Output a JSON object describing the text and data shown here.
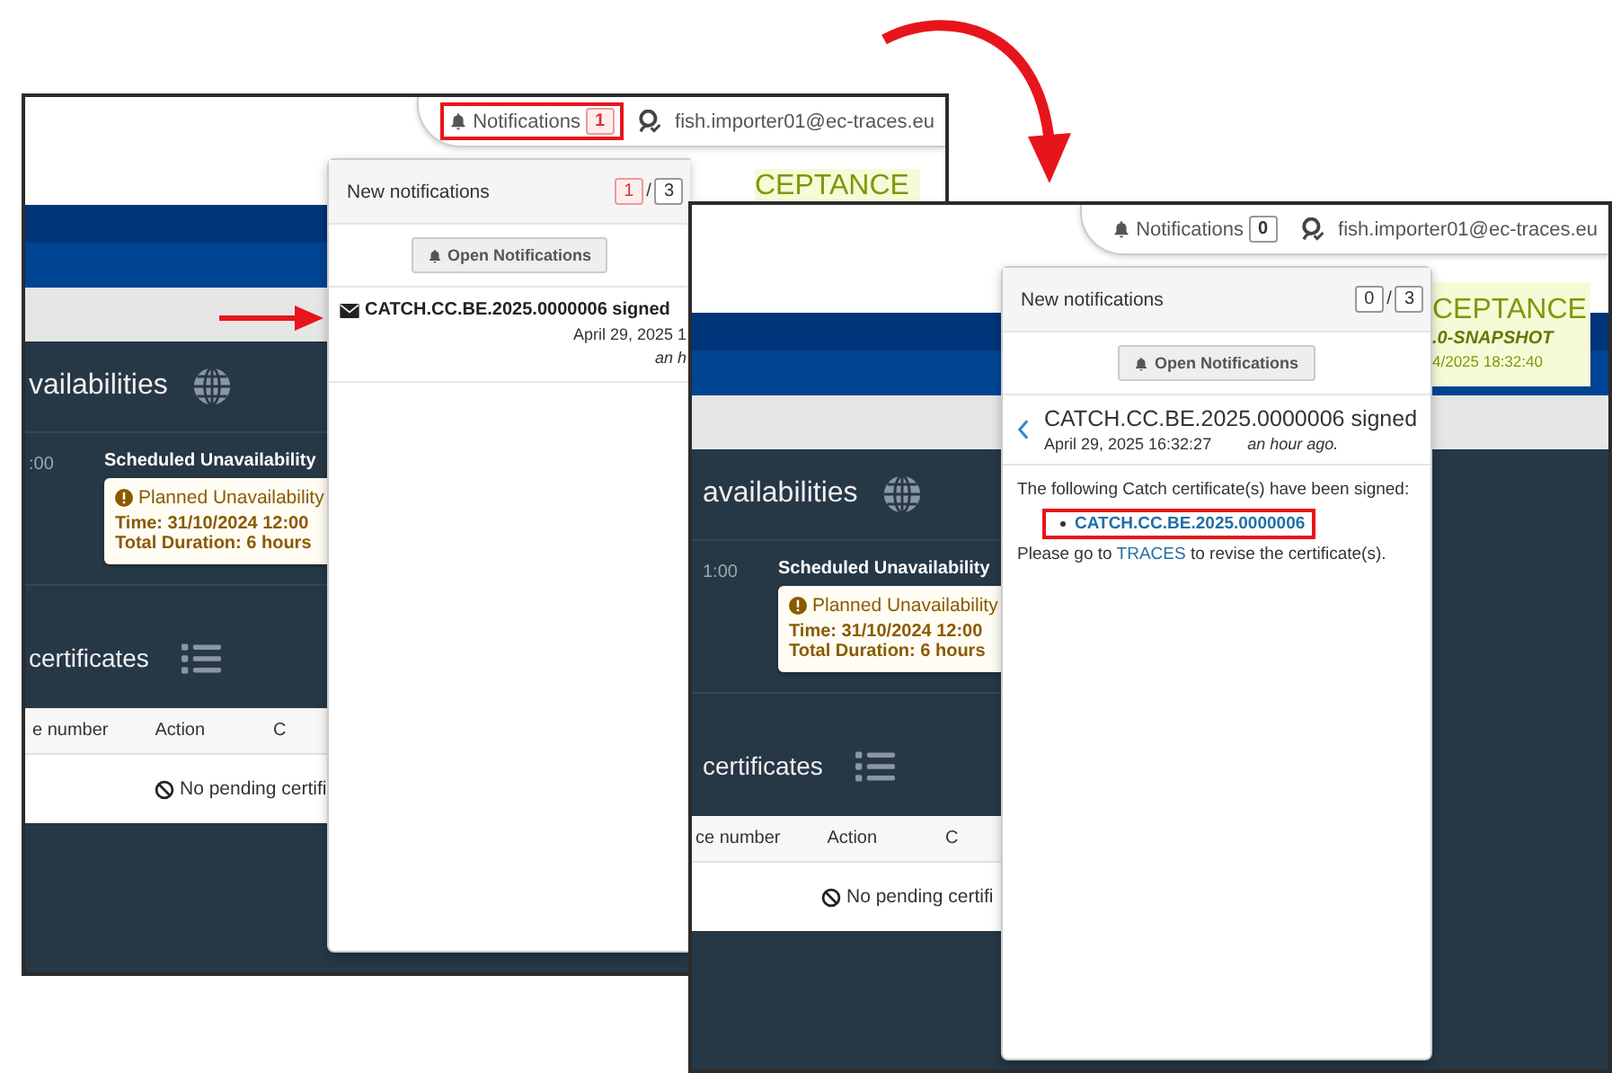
{
  "screenshots": [
    {
      "kind": "list",
      "pointer_arrow": true,
      "user_menu": {
        "notifications_label": "Notifications",
        "notifications_count": "1",
        "count_unread": true,
        "highlighted": true,
        "user": "fish.importer01@ec-traces.eu"
      },
      "env_badge": {
        "lines": [
          "CEPTANCE"
        ]
      },
      "unavailabilities": {
        "title": "vailabilities",
        "time": ":00",
        "heading": "Scheduled Unavailability",
        "notice": "Planned Unavailability",
        "time_line": "Time: 31/10/2024 12:00",
        "duration": "Total Duration: 6 hours"
      },
      "certificates": {
        "title": "certificates",
        "columns": [
          "e number",
          "Action",
          "C"
        ],
        "empty": "No pending certifi"
      },
      "dropdown": {
        "title": "New notifications",
        "unread": "1",
        "unread_highlighted": true,
        "separator": "/",
        "total": "3",
        "button": "Open Notifications",
        "item": {
          "title": "CATCH.CC.BE.2025.0000006 signed",
          "date": "April 29, 2025 1",
          "ago": "an h"
        }
      }
    },
    {
      "kind": "detail",
      "user_menu": {
        "notifications_label": "Notifications",
        "notifications_count": "0",
        "count_unread": false,
        "highlighted": false,
        "user": "fish.importer01@ec-traces.eu"
      },
      "env_badge": {
        "lines": [
          "CEPTANCE",
          ".0-SNAPSHOT",
          "4/2025 18:32:40"
        ]
      },
      "unavailabilities": {
        "title": "availabilities",
        "time": "1:00",
        "heading": "Scheduled Unavailability",
        "notice": "Planned Unavailability",
        "time_line": "Time: 31/10/2024 12:00",
        "duration": "Total Duration: 6 hours"
      },
      "certificates": {
        "title": "certificates",
        "columns": [
          "ce number",
          "Action",
          "C"
        ],
        "empty": "No pending certifi"
      },
      "dropdown": {
        "title": "New notifications",
        "unread": "0",
        "unread_highlighted": false,
        "separator": "/",
        "total": "3",
        "button": "Open Notifications",
        "detail": {
          "title": "CATCH.CC.BE.2025.0000006 signed",
          "date": "April 29, 2025 16:32:27",
          "ago": "an hour ago.",
          "intro": "The following Catch certificate(s) have been signed:",
          "links": [
            {
              "text": "CATCH.CC.BE.2025.0000006",
              "highlighted": true
            }
          ],
          "outro_before": "Please go to",
          "outro_link": "TRACES",
          "outro_after": "to revise the certificate(s)."
        }
      }
    }
  ]
}
